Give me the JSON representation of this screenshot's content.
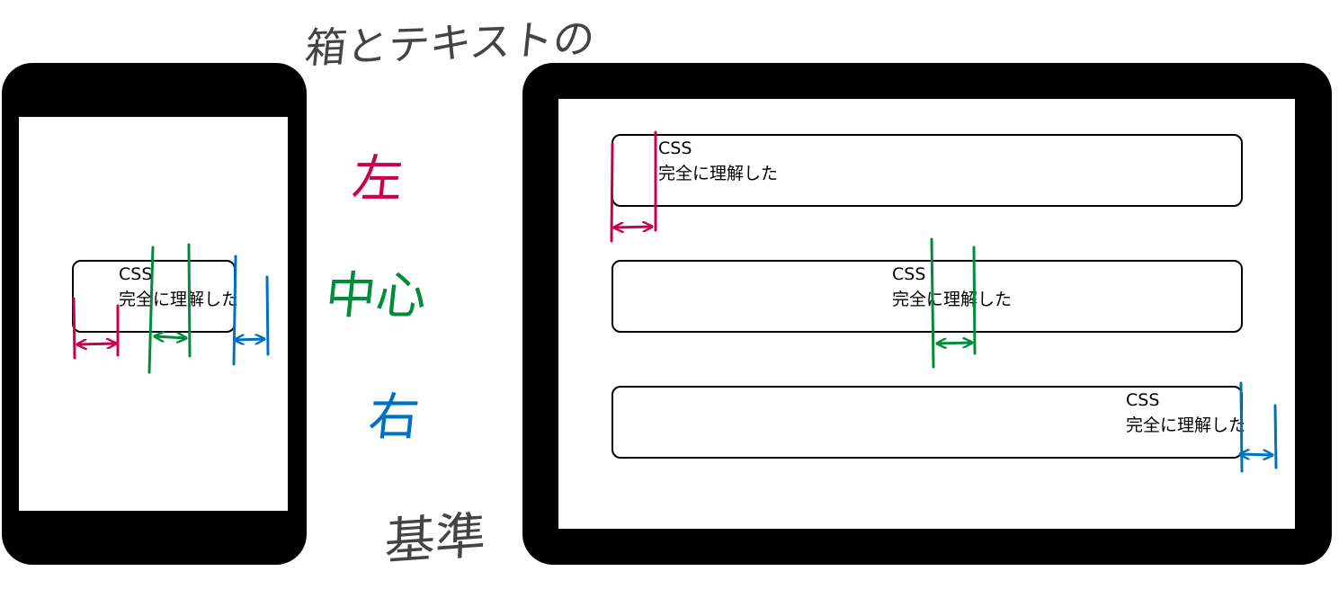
{
  "handwritten": {
    "title": "箱とテキストの",
    "left": "左",
    "center": "中心",
    "right": "右",
    "basis": "基準"
  },
  "sample_text": {
    "line1": "CSS",
    "line2": "完全に理解した"
  },
  "colors": {
    "left": "#c8004e",
    "center": "#008c3a",
    "right": "#0070c0",
    "ink": "#444444",
    "device": "#000000"
  }
}
